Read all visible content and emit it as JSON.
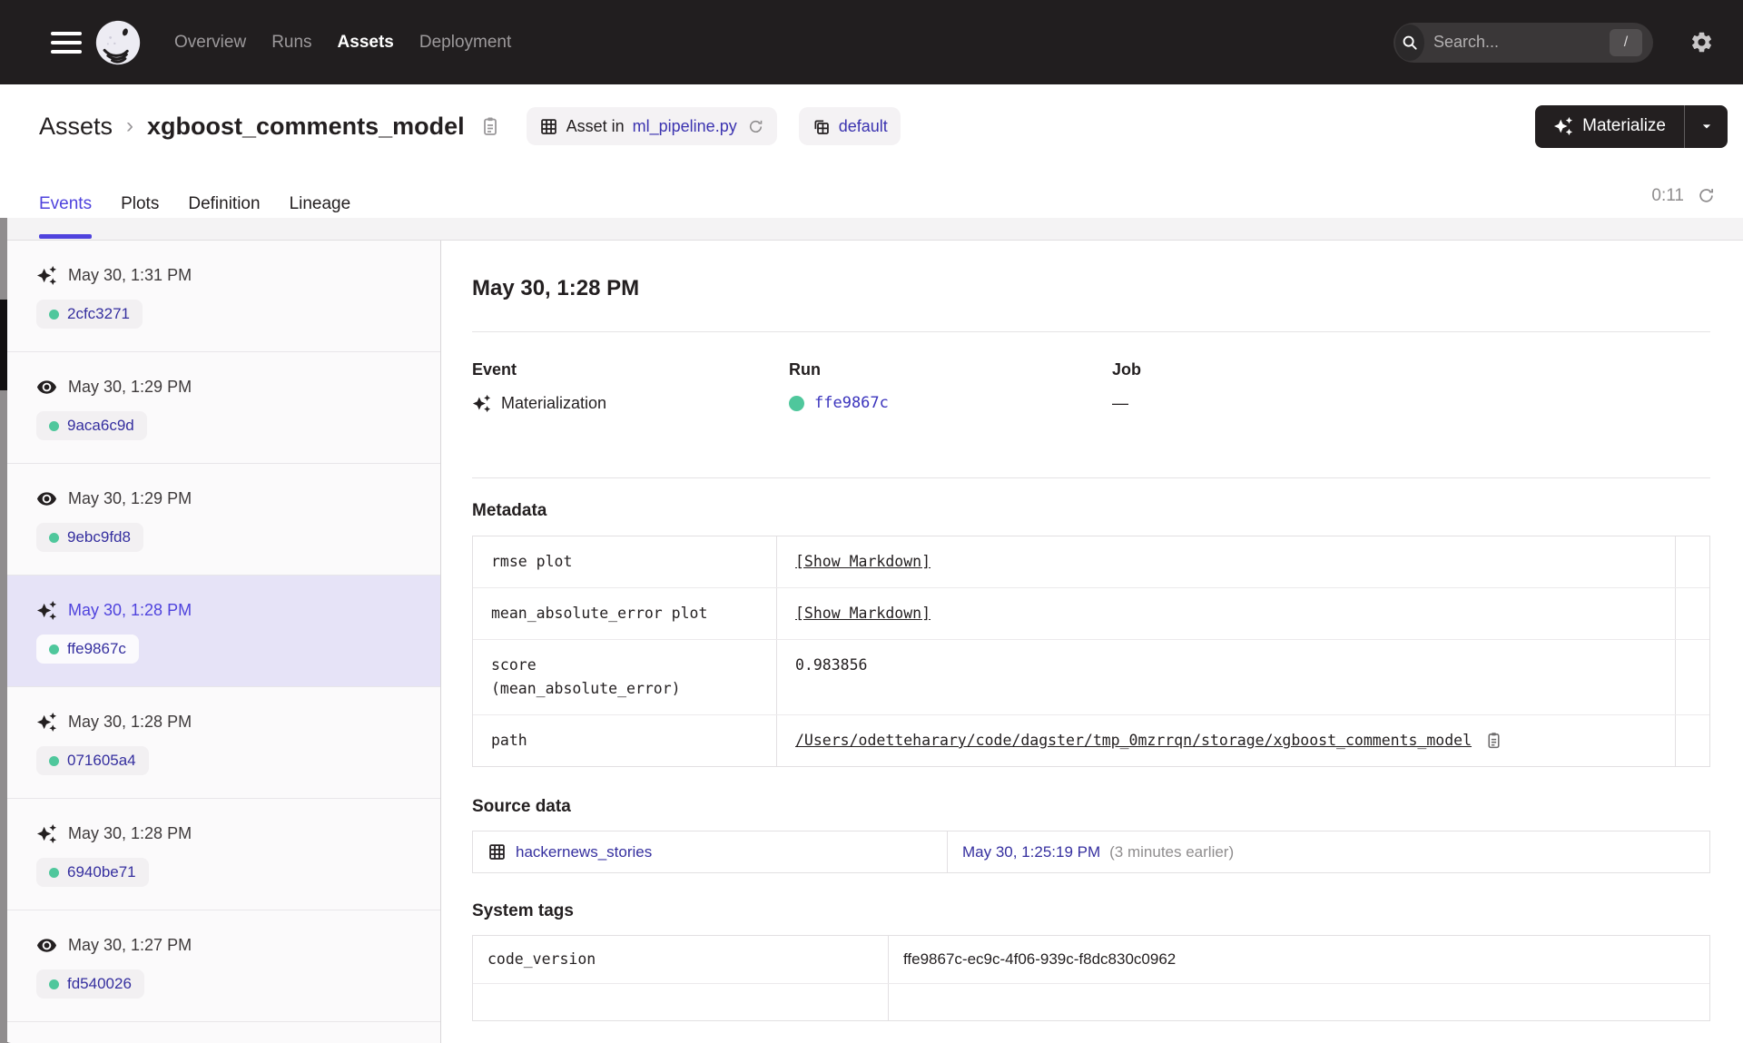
{
  "colors": {
    "accent": "#4f43dd",
    "link_indigo": "#352f9f",
    "success_green": "#4fc79c",
    "nav_bg": "#211e1f"
  },
  "nav": {
    "items": [
      {
        "label": "Overview"
      },
      {
        "label": "Runs"
      },
      {
        "label": "Assets"
      },
      {
        "label": "Deployment"
      }
    ],
    "search": {
      "placeholder": "Search...",
      "shortcut": "/"
    }
  },
  "page_header": {
    "breadcrumb": {
      "root": "Assets",
      "separator": "›",
      "current": "xgboost_comments_model"
    },
    "asset_location_badge": {
      "prefix": "Asset in",
      "file": "ml_pipeline.py"
    },
    "repo_badge": {
      "label": "default"
    },
    "materialize": {
      "label": "Materialize"
    }
  },
  "tabs": {
    "items": [
      {
        "label": "Events"
      },
      {
        "label": "Plots"
      },
      {
        "label": "Definition"
      },
      {
        "label": "Lineage"
      }
    ],
    "refresh_timer": "0:11"
  },
  "event_list": [
    {
      "type": "materialization",
      "time": "May 30, 1:31 PM",
      "run_id": "2cfc3271",
      "selected": false
    },
    {
      "type": "observation",
      "time": "May 30, 1:29 PM",
      "run_id": "9aca6c9d",
      "selected": false
    },
    {
      "type": "observation",
      "time": "May 30, 1:29 PM",
      "run_id": "9ebc9fd8",
      "selected": false
    },
    {
      "type": "materialization",
      "time": "May 30, 1:28 PM",
      "run_id": "ffe9867c",
      "selected": true
    },
    {
      "type": "materialization",
      "time": "May 30, 1:28 PM",
      "run_id": "071605a4",
      "selected": false
    },
    {
      "type": "materialization",
      "time": "May 30, 1:28 PM",
      "run_id": "6940be71",
      "selected": false
    },
    {
      "type": "observation",
      "time": "May 30, 1:27 PM",
      "run_id": "fd540026",
      "selected": false
    }
  ],
  "detail": {
    "heading": "May 30, 1:28 PM",
    "event": {
      "label": "Event",
      "value": "Materialization"
    },
    "run": {
      "label": "Run",
      "value": "ffe9867c"
    },
    "job": {
      "label": "Job",
      "value": "—"
    },
    "metadata": {
      "title": "Metadata",
      "rows": [
        {
          "key": "rmse plot",
          "value": "[Show Markdown]"
        },
        {
          "key": "mean_absolute_error plot",
          "value": "[Show Markdown]"
        },
        {
          "key": "score\n(mean_absolute_error)",
          "value": "0.983856"
        },
        {
          "key": "path",
          "value": "/Users/odetteharary/code/dagster/tmp_0mzrrqn/storage/xgboost_comments_model"
        }
      ]
    },
    "source_data": {
      "title": "Source data",
      "asset": "hackernews_stories",
      "timestamp": "May 30, 1:25:19 PM",
      "relative": "(3 minutes earlier)"
    },
    "system_tags": {
      "title": "System tags",
      "rows": [
        {
          "key": "code_version",
          "value": "ffe9867c-ec9c-4f06-939c-f8dc830c0962"
        }
      ]
    }
  }
}
